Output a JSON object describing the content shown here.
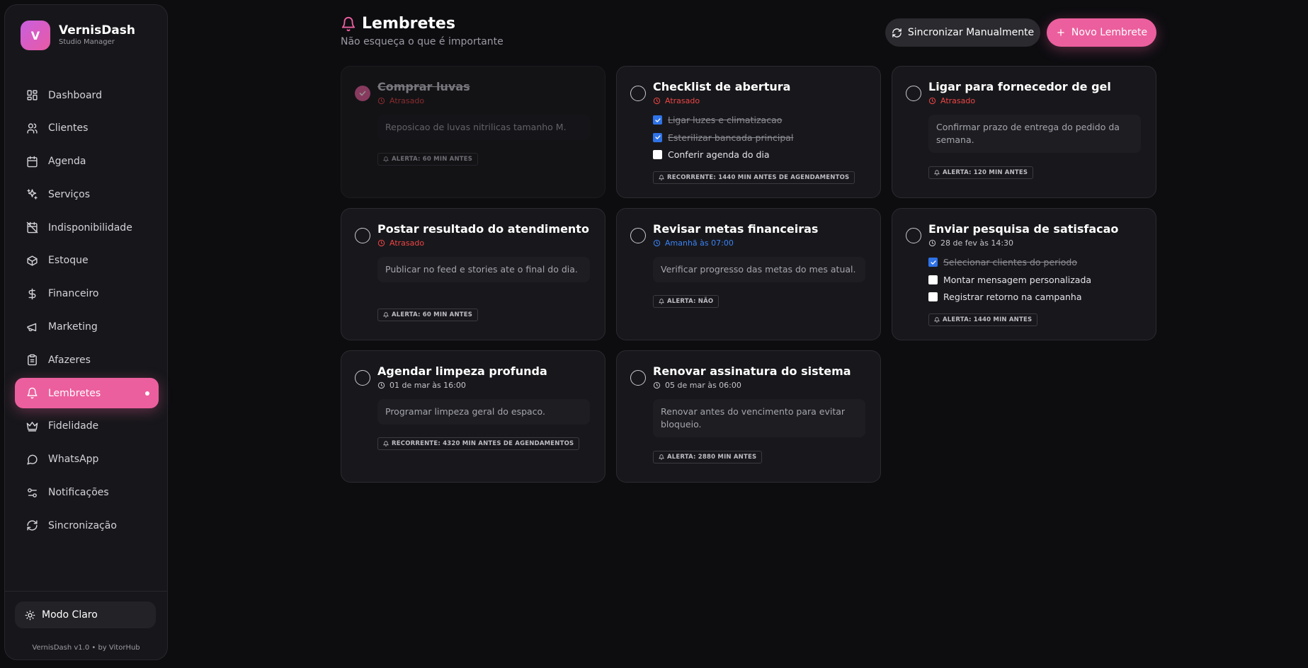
{
  "brand": {
    "logo_letter": "V",
    "name": "VernisDash",
    "subtitle": "Studio Manager"
  },
  "nav": [
    {
      "label": "Dashboard",
      "icon": "dashboard-icon"
    },
    {
      "label": "Clientes",
      "icon": "users-icon"
    },
    {
      "label": "Agenda",
      "icon": "calendar-icon"
    },
    {
      "label": "Serviços",
      "icon": "sparkles-icon"
    },
    {
      "label": "Indisponibilidade",
      "icon": "calendar-off-icon"
    },
    {
      "label": "Estoque",
      "icon": "box-icon"
    },
    {
      "label": "Financeiro",
      "icon": "dollar-icon"
    },
    {
      "label": "Marketing",
      "icon": "megaphone-icon"
    },
    {
      "label": "Afazeres",
      "icon": "clipboard-icon"
    },
    {
      "label": "Lembretes",
      "icon": "bell-icon",
      "active": true
    },
    {
      "label": "Fidelidade",
      "icon": "crown-icon"
    },
    {
      "label": "WhatsApp",
      "icon": "chat-icon"
    },
    {
      "label": "Notificações",
      "icon": "sliders-icon"
    },
    {
      "label": "Sincronização",
      "icon": "refresh-icon"
    }
  ],
  "mode_toggle": "Modo Claro",
  "version": "VernisDash v1.0 • by VitorHub",
  "header": {
    "title": "Lembretes",
    "subtitle": "Não esqueça o que é importante",
    "sync_button": "Sincronizar Manualmente",
    "new_button": "Novo Lembrete"
  },
  "colors": {
    "accent": "#ec5f9e",
    "late": "#ef4444",
    "soon": "#3b82f6",
    "checkbox": "#2f73e8"
  },
  "cards": [
    {
      "title": "Comprar luvas",
      "done": true,
      "time": "Atrasado",
      "time_status": "late",
      "description": "Reposicao de luvas nitrilicas tamanho M.",
      "badge": "ALERTA: 60 MIN ANTES"
    },
    {
      "title": "Checklist de abertura",
      "done": false,
      "time": "Atrasado",
      "time_status": "late",
      "checklist": [
        {
          "label": "Ligar luzes e climatizacao",
          "checked": true
        },
        {
          "label": "Esterilizar bancada principal",
          "checked": true
        },
        {
          "label": "Conferir agenda do dia",
          "checked": false
        }
      ],
      "badge": "RECORRENTE: 1440 MIN ANTES DE AGENDAMENTOS"
    },
    {
      "title": "Ligar para fornecedor de gel",
      "done": false,
      "time": "Atrasado",
      "time_status": "late",
      "description": "Confirmar prazo de entrega do pedido da semana.",
      "badge": "ALERTA: 120 MIN ANTES"
    },
    {
      "title": "Postar resultado do atendimento",
      "done": false,
      "time": "Atrasado",
      "time_status": "late",
      "description": "Publicar no feed e stories ate o final do dia.",
      "badge": "ALERTA: 60 MIN ANTES"
    },
    {
      "title": "Revisar metas financeiras",
      "done": false,
      "time": "Amanhã às 07:00",
      "time_status": "soon",
      "description": "Verificar progresso das metas do mes atual.",
      "badge": "ALERTA: NÃO"
    },
    {
      "title": "Enviar pesquisa de satisfacao",
      "done": false,
      "time": "28 de fev às 14:30",
      "time_status": "normal",
      "checklist": [
        {
          "label": "Selecionar clientes do periodo",
          "checked": true
        },
        {
          "label": "Montar mensagem personalizada",
          "checked": false
        },
        {
          "label": "Registrar retorno na campanha",
          "checked": false
        }
      ],
      "badge": "ALERTA: 1440 MIN ANTES"
    },
    {
      "title": "Agendar limpeza profunda",
      "done": false,
      "time": "01 de mar às 16:00",
      "time_status": "normal",
      "description": "Programar limpeza geral do espaco.",
      "badge": "RECORRENTE: 4320 MIN ANTES DE AGENDAMENTOS"
    },
    {
      "title": "Renovar assinatura do sistema",
      "done": false,
      "time": "05 de mar às 06:00",
      "time_status": "normal",
      "description": "Renovar antes do vencimento para evitar bloqueio.",
      "badge": "ALERTA: 2880 MIN ANTES"
    }
  ]
}
